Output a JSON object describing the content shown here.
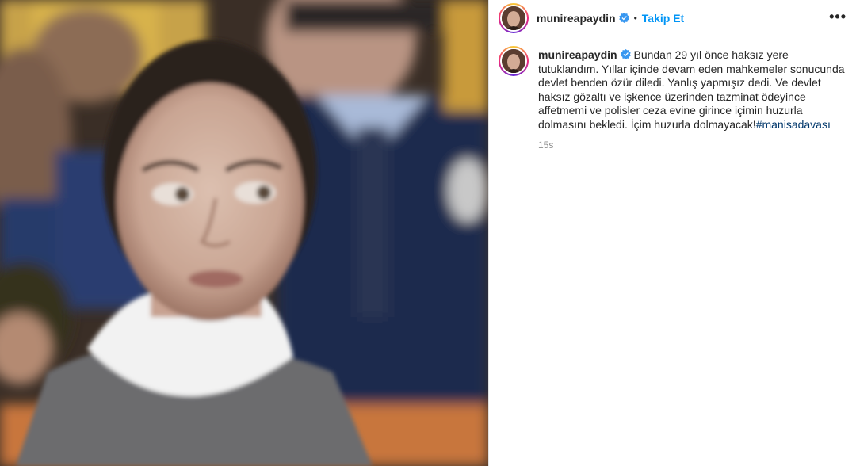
{
  "header": {
    "username": "munireapaydin",
    "dot": "•",
    "follow_label": "Takip Et",
    "more_label": "•••"
  },
  "caption": {
    "username": "munireapaydin",
    "text": "Bundan 29 yıl önce haksız yere tutuklandım. Yıllar içinde devam eden mahkemeler sonucunda devlet benden özür diledi. Yanlış yapmışız dedi. Ve devlet haksız gözaltı ve işkence üzerinden tazminat ödeyince affetmemi ve polisler ceza evine girince içimin huzurla dolmasını bekledi. İçim huzurla dolmayacak!",
    "hashtag": "#manisadavası",
    "time": "15s"
  },
  "colors": {
    "accent": "#0095f6",
    "verified": "#3897f0",
    "hashtag": "#00376b"
  },
  "icons": [
    "verified-badge-icon",
    "more-options-icon"
  ]
}
